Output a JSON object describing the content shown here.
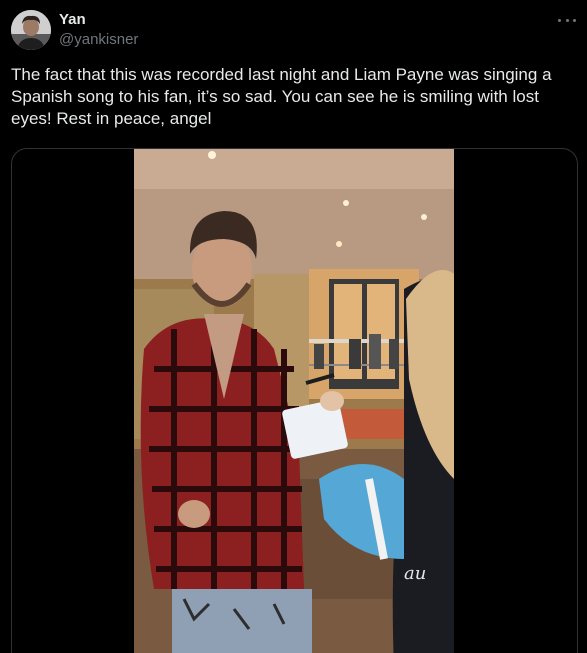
{
  "author": {
    "display_name": "Yan",
    "handle": "@yankisner",
    "avatar_icon": "avatar-photo"
  },
  "tweet": {
    "text": "The fact that this was recorded last night and Liam Payne was singing a Spanish song to his fan, it’s so sad. You can see he is smiling with lost eyes! Rest in peace, angel"
  },
  "icons": {
    "more": "more-horizontal-icon"
  },
  "colors": {
    "background": "#000000",
    "text": "#e7e9ea",
    "secondary_text": "#71767b",
    "border": "#2f3336"
  }
}
